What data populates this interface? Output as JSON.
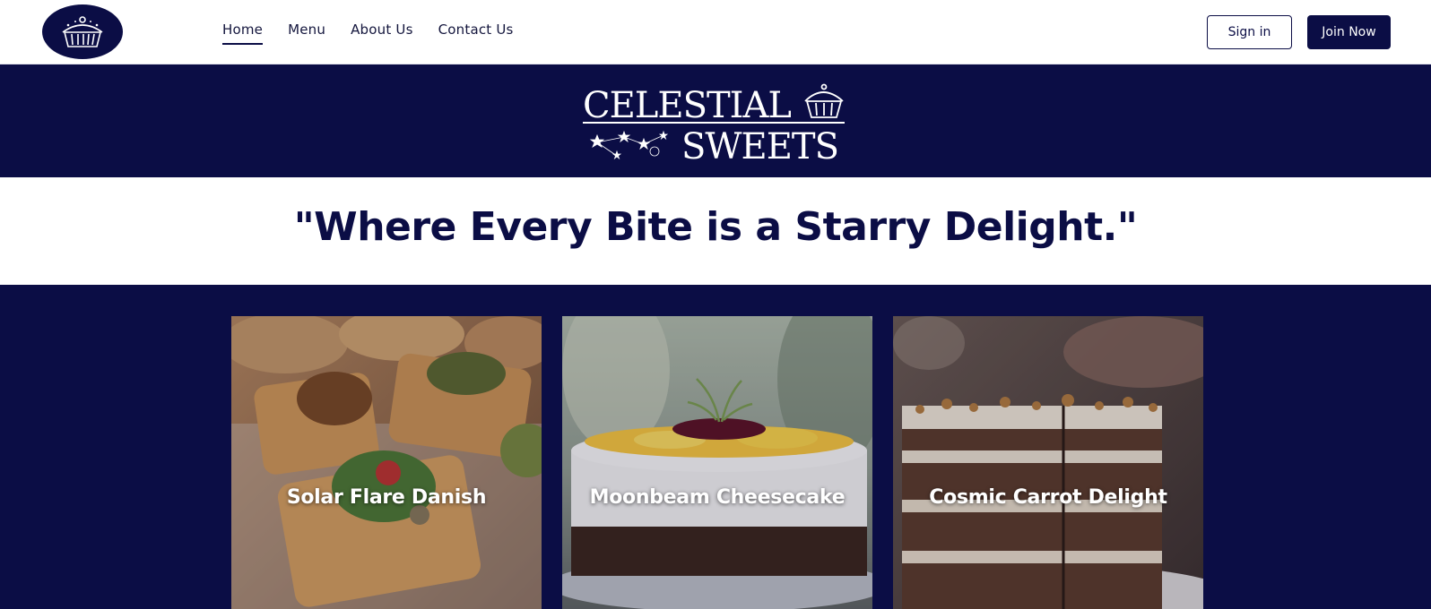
{
  "colors": {
    "navy": "#0b0d45",
    "white": "#ffffff"
  },
  "nav": {
    "logo_icon": "cupcake-logo-icon",
    "links": [
      {
        "label": "Home",
        "active": true
      },
      {
        "label": "Menu",
        "active": false
      },
      {
        "label": "About Us",
        "active": false
      },
      {
        "label": "Contact Us",
        "active": false
      }
    ],
    "signin_label": "Sign in",
    "join_label": "Join Now"
  },
  "brand": {
    "line1": "CELESTIAL",
    "line2": "SWEETS",
    "icon": "cupcake-icon"
  },
  "tagline": "\"Where Every Bite is a Starry Delight.\"",
  "products": [
    {
      "name": "Solar Flare Danish"
    },
    {
      "name": "Moonbeam Cheesecake"
    },
    {
      "name": "Cosmic Carrot Delight"
    }
  ]
}
